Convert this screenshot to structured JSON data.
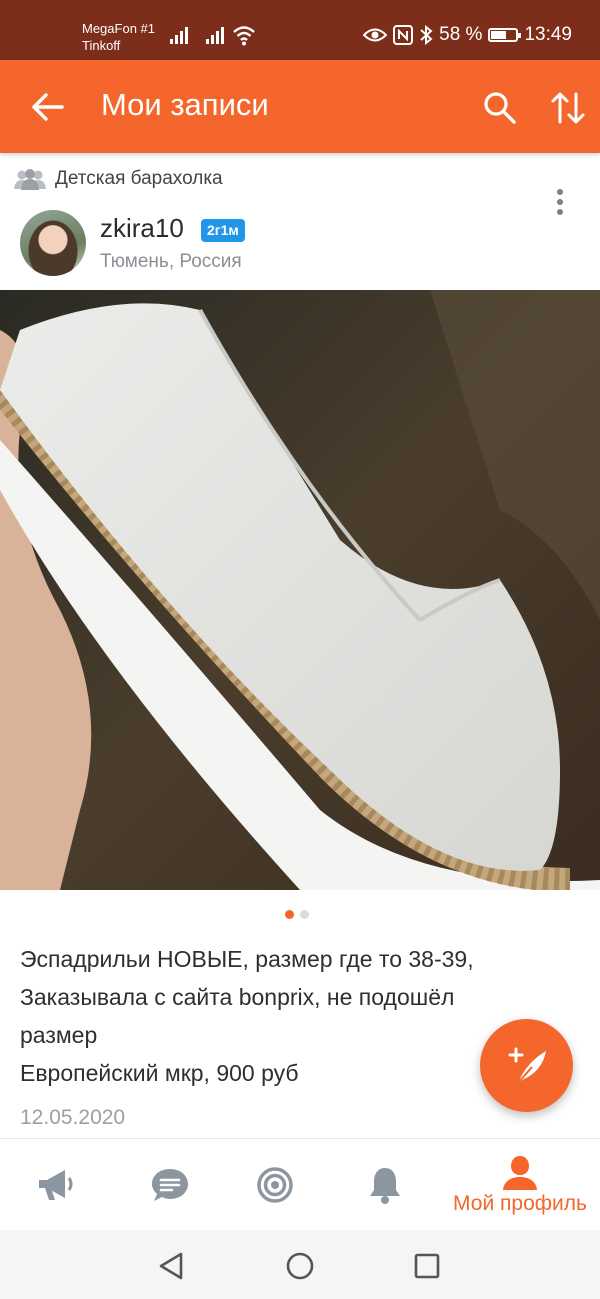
{
  "status_bar": {
    "carrier_1": "MegaFon #1",
    "carrier_2": "Tinkoff",
    "battery_percent": "58 %",
    "time": "13:49"
  },
  "app_bar": {
    "title": "Мои записи",
    "icons": [
      "arrow-back-icon",
      "search-icon",
      "sort-icon"
    ]
  },
  "post": {
    "group_name": "Детская барахолка",
    "author": {
      "username": "zkira10",
      "badge": "2г1м",
      "location": "Тюмень, Россия"
    },
    "photo": {
      "subject": "white espadrille shoe held in hand",
      "current_index": 1,
      "total": 2
    },
    "text_lines": [
      "Эспадрильи НОВЫЕ, размер где то 38-39,",
      "Заказывала с сайта bonprix, не подошёл",
      "размер",
      "Европейский мкр, 900 руб"
    ],
    "date": "12.05.2020"
  },
  "bottom_nav": {
    "items": [
      {
        "icon": "megaphone-icon",
        "label": ""
      },
      {
        "icon": "chat-bubble-icon",
        "label": ""
      },
      {
        "icon": "target-icon",
        "label": ""
      },
      {
        "icon": "bell-icon",
        "label": ""
      },
      {
        "icon": "profile-icon",
        "label": "Мой профиль"
      }
    ]
  },
  "colors": {
    "accent": "#f4662b",
    "status_bar": "#7c2e1a",
    "badge": "#2196e8",
    "icon_gray": "#8c96a0"
  }
}
